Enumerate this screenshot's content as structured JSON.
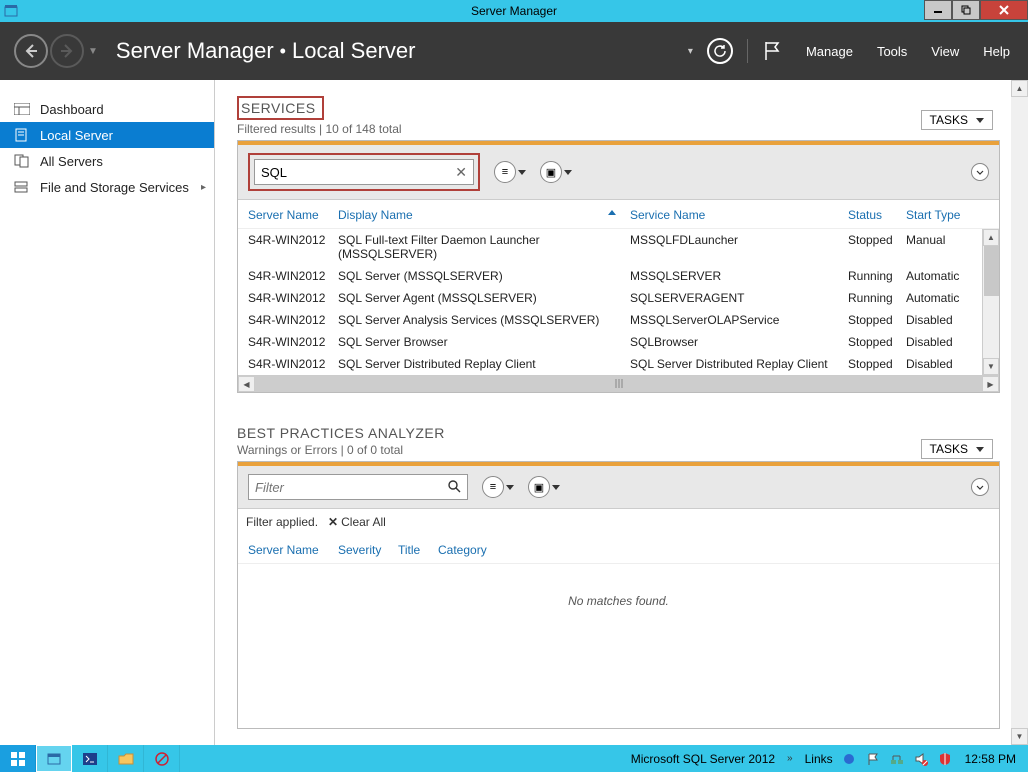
{
  "titlebar": {
    "title": "Server Manager"
  },
  "window_controls": {
    "min": "—",
    "max": "❐",
    "close": "✕"
  },
  "breadcrumb": {
    "app": "Server Manager",
    "location": "Local Server",
    "menu": {
      "manage": "Manage",
      "tools": "Tools",
      "view": "View",
      "help": "Help"
    }
  },
  "sidebar": {
    "items": [
      {
        "label": "Dashboard"
      },
      {
        "label": "Local Server"
      },
      {
        "label": "All Servers"
      },
      {
        "label": "File and Storage Services"
      }
    ]
  },
  "services": {
    "title": "SERVICES",
    "subtitle": "Filtered results | 10 of 148 total",
    "tasks_label": "TASKS",
    "filter_value": "SQL",
    "columns": {
      "server": "Server Name",
      "display": "Display Name",
      "service": "Service Name",
      "status": "Status",
      "start": "Start Type"
    },
    "rows": [
      {
        "server": "S4R-WIN2012",
        "display": "SQL Full-text Filter Daemon Launcher (MSSQLSERVER)",
        "service": "MSSQLFDLauncher",
        "status": "Stopped",
        "start": "Manual"
      },
      {
        "server": "S4R-WIN2012",
        "display": "SQL Server (MSSQLSERVER)",
        "service": "MSSQLSERVER",
        "status": "Running",
        "start": "Automatic"
      },
      {
        "server": "S4R-WIN2012",
        "display": "SQL Server Agent (MSSQLSERVER)",
        "service": "SQLSERVERAGENT",
        "status": "Running",
        "start": "Automatic"
      },
      {
        "server": "S4R-WIN2012",
        "display": "SQL Server Analysis Services (MSSQLSERVER)",
        "service": "MSSQLServerOLAPService",
        "status": "Stopped",
        "start": "Disabled"
      },
      {
        "server": "S4R-WIN2012",
        "display": "SQL Server Browser",
        "service": "SQLBrowser",
        "status": "Stopped",
        "start": "Disabled"
      },
      {
        "server": "S4R-WIN2012",
        "display": "SQL Server Distributed Replay Client",
        "service": "SQL Server Distributed Replay Client",
        "status": "Stopped",
        "start": "Disabled"
      }
    ]
  },
  "bpa": {
    "title": "BEST PRACTICES ANALYZER",
    "subtitle": "Warnings or Errors | 0 of 0 total",
    "tasks_label": "TASKS",
    "filter_placeholder": "Filter",
    "filter_applied": "Filter applied.",
    "clear_all": "Clear All",
    "columns": {
      "server": "Server Name",
      "severity": "Severity",
      "title_col": "Title",
      "category": "Category"
    },
    "no_match": "No matches found."
  },
  "taskbar": {
    "status_text": "Microsoft SQL Server 2012",
    "links_label": "Links",
    "clock": "12:58 PM"
  }
}
